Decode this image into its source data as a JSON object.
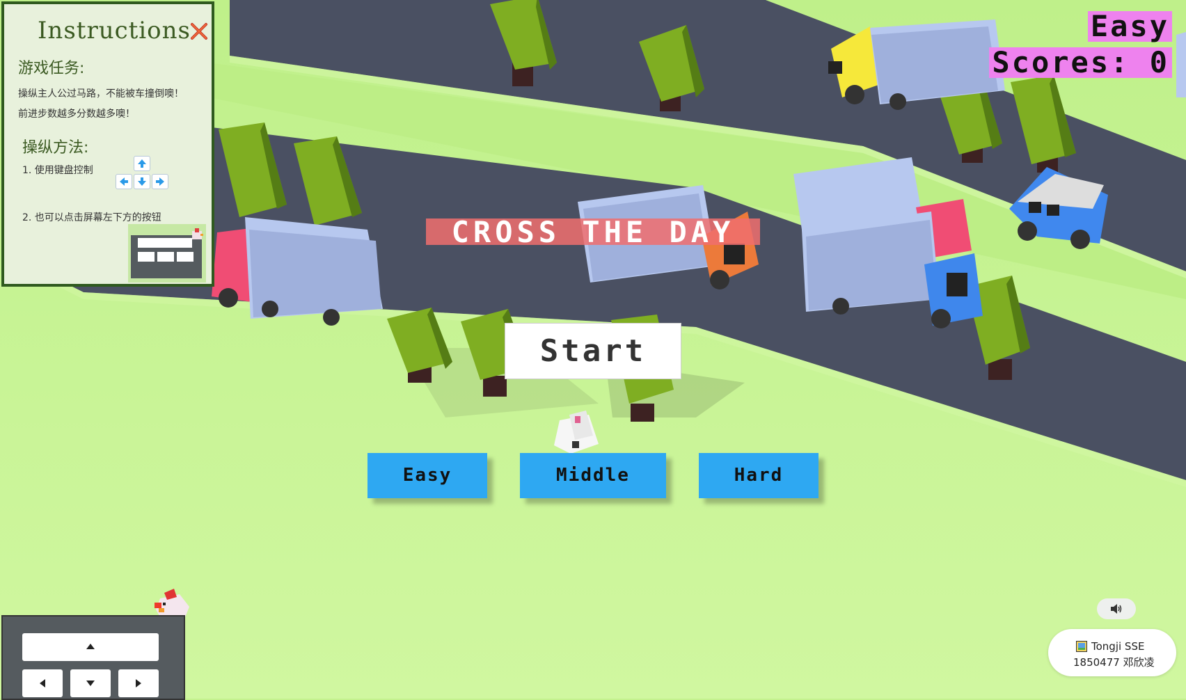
{
  "instructions": {
    "title": "Instructions",
    "task_heading": "游戏任务:",
    "task_line1": "操纵主人公过马路，不能被车撞倒噢！",
    "task_line2": "前进步数越多分数越多噢！",
    "controls_heading": "操纵方法:",
    "control_item1": "1.   使用键盘控制",
    "control_item2": "2.   也可以点击屏幕左下方的按钮"
  },
  "hud": {
    "difficulty": "Easy",
    "score_label": "Scores:",
    "score_value": "0"
  },
  "game_title": "CROSS THE DAY",
  "start_label": "Start",
  "difficulty_buttons": [
    "Easy",
    "Middle",
    "Hard"
  ],
  "badge": {
    "line1": "Tongji SSE",
    "line2": "1850477 邓欣凌"
  },
  "colors": {
    "grass": "#c4f18e",
    "road": "#4a5062",
    "button_blue": "#2ea8f2",
    "hud_pink": "#ee82ee",
    "title_red": "#f06e6e"
  },
  "icons": {
    "close": "close-icon",
    "sound": "speaker-icon",
    "arrows": [
      "arrow-up-icon",
      "arrow-left-icon",
      "arrow-down-icon",
      "arrow-right-icon"
    ]
  }
}
